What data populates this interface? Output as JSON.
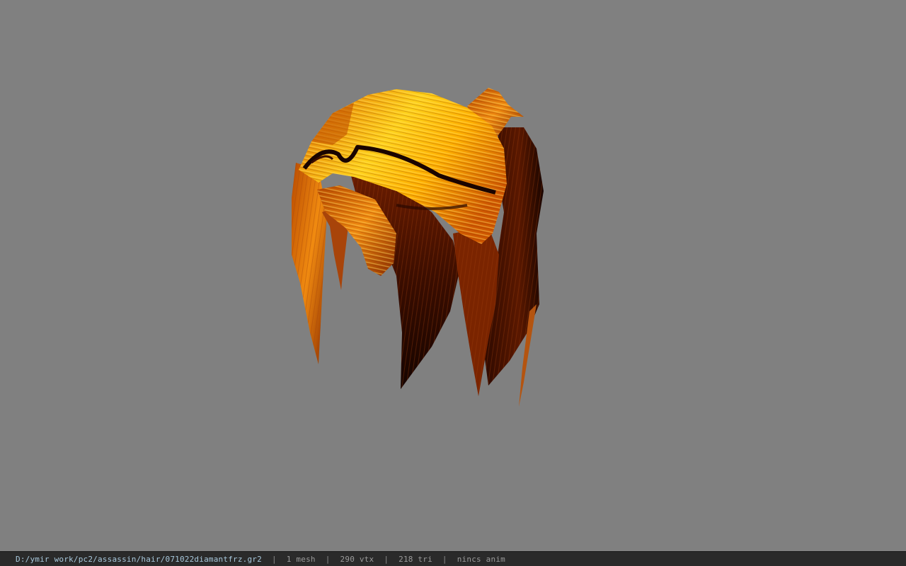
{
  "viewer": {
    "background_color": "#808080",
    "model_icon": "hair-mesh-model"
  },
  "status": {
    "file_path": "D:/ymir work/pc2/assassin/hair/071022diamantfrz.gr2",
    "separator": "|",
    "mesh_count": "1 mesh",
    "vertex_count": "290 vtx",
    "triangle_count": "218 tri",
    "anim": "nincs anim"
  }
}
